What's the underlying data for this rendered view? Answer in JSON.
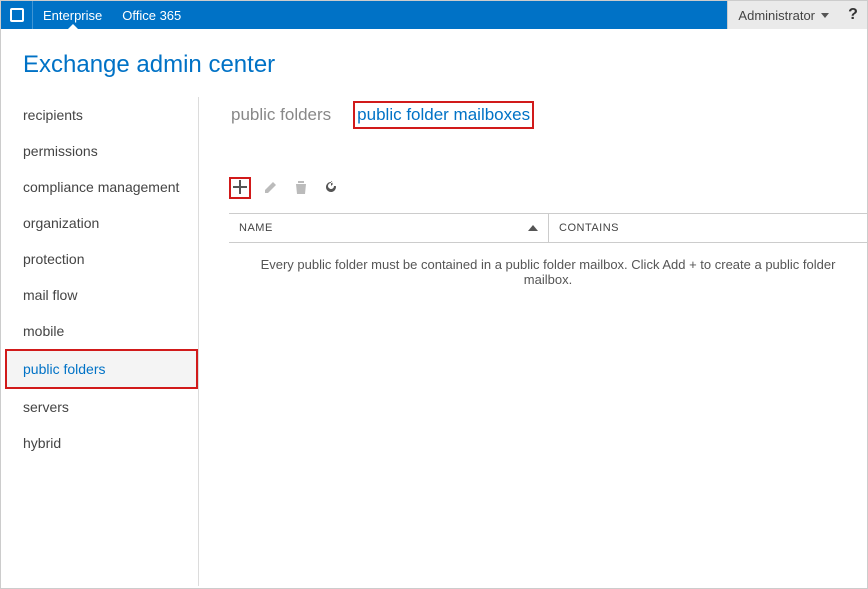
{
  "topbar": {
    "nav": [
      {
        "label": "Enterprise",
        "active": true
      },
      {
        "label": "Office 365",
        "active": false
      }
    ],
    "admin_label": "Administrator",
    "help_label": "?"
  },
  "page_title": "Exchange admin center",
  "sidebar": {
    "items": [
      {
        "label": "recipients",
        "active": false
      },
      {
        "label": "permissions",
        "active": false
      },
      {
        "label": "compliance management",
        "active": false
      },
      {
        "label": "organization",
        "active": false
      },
      {
        "label": "protection",
        "active": false
      },
      {
        "label": "mail flow",
        "active": false
      },
      {
        "label": "mobile",
        "active": false
      },
      {
        "label": "public folders",
        "active": true
      },
      {
        "label": "servers",
        "active": false
      },
      {
        "label": "hybrid",
        "active": false
      }
    ]
  },
  "tabs": [
    {
      "label": "public folders",
      "active": false
    },
    {
      "label": "public folder mailboxes",
      "active": true
    }
  ],
  "toolbar": {
    "add_title": "Add",
    "edit_title": "Edit",
    "delete_title": "Delete",
    "refresh_title": "Refresh"
  },
  "table": {
    "columns": {
      "name": "NAME",
      "contains": "CONTAINS"
    },
    "empty_message": "Every public folder must be contained in a public folder mailbox. Click Add + to create a public folder mailbox."
  }
}
